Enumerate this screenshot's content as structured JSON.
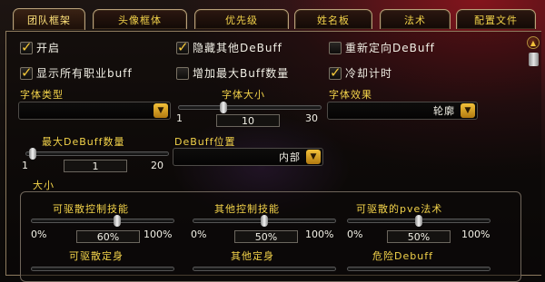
{
  "tabs": [
    {
      "label": "团队框架",
      "active": true
    },
    {
      "label": "头像框体",
      "active": false
    },
    {
      "label": "优先级",
      "active": false
    },
    {
      "label": "姓名板",
      "active": false
    },
    {
      "label": "法术",
      "active": false
    },
    {
      "label": "配置文件",
      "active": false
    }
  ],
  "checkboxes": [
    {
      "label": "开启",
      "checked": true
    },
    {
      "label": "隐藏其他DeBuff",
      "checked": true
    },
    {
      "label": "重新定向DeBuff",
      "checked": false
    },
    {
      "label": "显示所有职业buff",
      "checked": true
    },
    {
      "label": "增加最大Buff数量",
      "checked": false
    },
    {
      "label": "冷却计时",
      "checked": true
    }
  ],
  "font_type": {
    "label": "字体类型",
    "value": ""
  },
  "font_size": {
    "label": "字体大小",
    "min": "1",
    "max": "30",
    "value": "10"
  },
  "font_effect": {
    "label": "字体效果",
    "value": "轮廓"
  },
  "max_debuff": {
    "label": "最大DeBuff数量",
    "min": "1",
    "max": "20",
    "value": "1"
  },
  "debuff_position": {
    "label": "DeBuff位置",
    "value": "内部"
  },
  "size_section": {
    "label": "大小"
  },
  "size_sliders": [
    {
      "label": "可驱散控制技能",
      "min": "0%",
      "max": "100%",
      "value": "60%"
    },
    {
      "label": "其他控制技能",
      "min": "0%",
      "max": "100%",
      "value": "50%"
    },
    {
      "label": "可驱散的pve法术",
      "min": "0%",
      "max": "100%",
      "value": "50%"
    }
  ],
  "size_row2": [
    {
      "label": "可驱散定身"
    },
    {
      "label": "其他定身"
    },
    {
      "label": "危险Debuff"
    }
  ],
  "colors": {
    "accent": "#f3d34a",
    "text": "#f2f0e6",
    "border": "#8d7b5e"
  }
}
